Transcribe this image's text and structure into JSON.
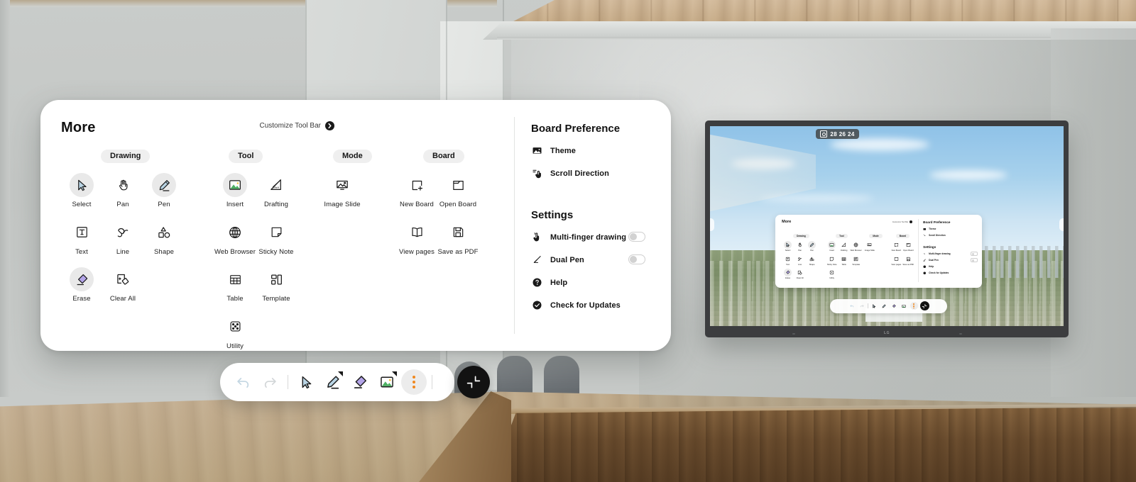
{
  "panel": {
    "title": "More",
    "customize": {
      "label": "Customize Tool Bar",
      "icon": "chevron-right-circle-icon"
    },
    "groups": [
      {
        "name": "Drawing",
        "items": [
          {
            "label": "Select",
            "icon": "cursor-arrow-icon",
            "selected": true
          },
          {
            "label": "Pan",
            "icon": "hand-icon",
            "selected": false
          },
          {
            "label": "Pen",
            "icon": "pen-icon",
            "selected": true
          },
          {
            "label": "Text",
            "icon": "text-box-icon",
            "selected": false
          },
          {
            "label": "Line",
            "icon": "squiggle-line-icon",
            "selected": false
          },
          {
            "label": "Shape",
            "icon": "shapes-icon",
            "selected": false
          },
          {
            "label": "Erase",
            "icon": "eraser-icon",
            "selected": true
          },
          {
            "label": "Clear All",
            "icon": "clear-all-icon",
            "selected": false
          }
        ]
      },
      {
        "name": "Tool",
        "items": [
          {
            "label": "Insert",
            "icon": "image-insert-icon",
            "selected": true
          },
          {
            "label": "Drafting",
            "icon": "ruler-triangle-icon",
            "selected": false
          },
          {
            "label": "Web Browser",
            "icon": "globe-icon",
            "selected": false
          },
          {
            "label": "Sticky Note",
            "icon": "sticky-note-icon",
            "selected": false
          },
          {
            "label": "Table",
            "icon": "table-grid-icon",
            "selected": false
          },
          {
            "label": "Template",
            "icon": "template-layout-icon",
            "selected": false
          },
          {
            "label": "Utility",
            "icon": "dice-icon",
            "selected": false
          }
        ]
      },
      {
        "name": "Mode",
        "items": [
          {
            "label": "Image Slide",
            "icon": "image-slide-icon",
            "selected": false
          }
        ]
      },
      {
        "name": "Board",
        "items": [
          {
            "label": "New Board",
            "icon": "new-board-plus-icon",
            "selected": false
          },
          {
            "label": "Open Board",
            "icon": "folder-open-icon",
            "selected": false
          },
          {
            "label": "View pages",
            "icon": "book-pages-icon",
            "selected": false
          },
          {
            "label": "Save as PDF",
            "icon": "floppy-save-icon",
            "selected": false
          }
        ]
      }
    ],
    "sidebar": {
      "board_preference_title": "Board Preference",
      "board_preference_items": [
        {
          "label": "Theme",
          "icon": "theme-image-icon"
        },
        {
          "label": "Scroll Direction",
          "icon": "scroll-hand-icon"
        }
      ],
      "settings_title": "Settings",
      "settings_items": [
        {
          "label": "Multi-finger drawing",
          "icon": "multi-finger-icon",
          "toggle": true,
          "on": false
        },
        {
          "label": "Dual Pen",
          "icon": "dual-pen-icon",
          "toggle": true,
          "on": false
        },
        {
          "label": "Help",
          "icon": "help-circle-icon",
          "toggle": false
        },
        {
          "label": "Check for Updates",
          "icon": "check-circle-icon",
          "toggle": false
        }
      ]
    }
  },
  "toolbar": {
    "items": [
      {
        "name": "undo",
        "icon": "undo-arrow-icon",
        "disabled": true
      },
      {
        "name": "redo",
        "icon": "redo-arrow-icon",
        "disabled": true
      },
      {
        "name": "select",
        "icon": "cursor-arrow-icon",
        "disabled": false
      },
      {
        "name": "pen",
        "icon": "pen-icon",
        "disabled": false
      },
      {
        "name": "eraser",
        "icon": "eraser-icon",
        "disabled": false
      },
      {
        "name": "image",
        "icon": "image-insert-icon",
        "disabled": false
      },
      {
        "name": "more",
        "icon": "more-dots-icon",
        "disabled": false
      }
    ],
    "collapse": {
      "name": "collapse",
      "icon": "collapse-corner-icon"
    }
  },
  "display": {
    "badge": {
      "text": "28 26 24",
      "icon": "screen-id-icon"
    },
    "brand": "LG"
  },
  "colors": {
    "accent_orange": "#f0881f",
    "pen_blue": "#b9d4e4",
    "eraser_purple": "#b3a4e8",
    "image_green": "#4caf62",
    "pill_grey": "#efefef",
    "selected_grey": "#e9e9e9",
    "panel_white": "#ffffff",
    "text_dark": "#111111",
    "wall_grey": "#c8cbc9"
  }
}
